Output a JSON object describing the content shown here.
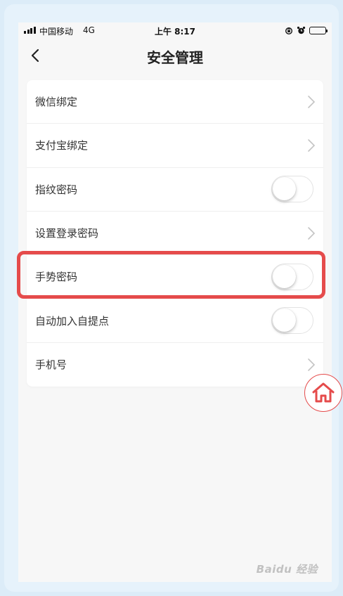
{
  "status_bar": {
    "carrier": "中国移动",
    "network": "4G",
    "time": "上午 8:17"
  },
  "nav": {
    "title": "安全管理",
    "back_icon": "chevron-left-icon"
  },
  "settings": [
    {
      "label": "微信绑定",
      "control": "chevron"
    },
    {
      "label": "支付宝绑定",
      "control": "chevron"
    },
    {
      "label": "指纹密码",
      "control": "toggle",
      "on": false
    },
    {
      "label": "设置登录密码",
      "control": "chevron"
    },
    {
      "label": "手势密码",
      "control": "toggle",
      "on": false
    },
    {
      "label": "自动加入自提点",
      "control": "toggle",
      "on": false
    },
    {
      "label": "手机号",
      "control": "chevron"
    }
  ],
  "highlight": {
    "target": "手势密码",
    "color": "#e54b4b"
  },
  "home_button": {
    "icon": "home-icon",
    "color": "#e54b4b"
  },
  "watermark": "Baidu 经验"
}
